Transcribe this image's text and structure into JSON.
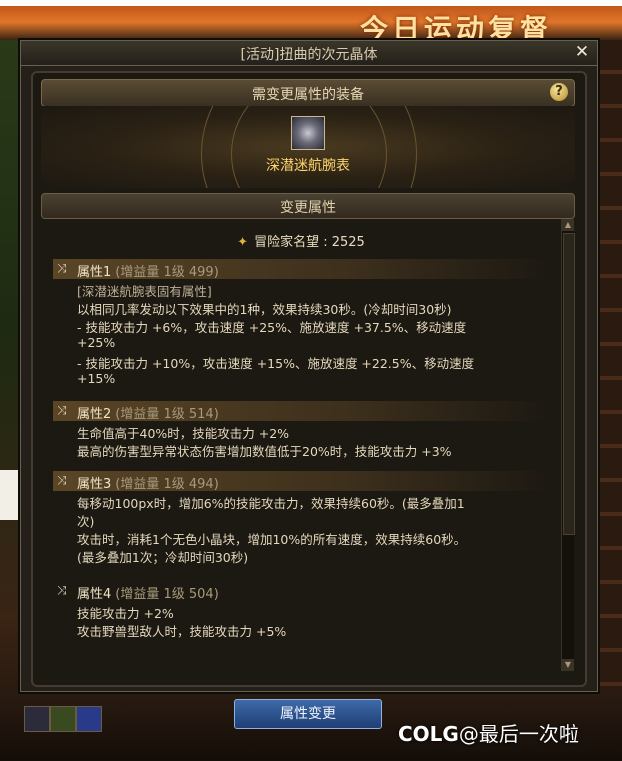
{
  "dialog": {
    "title": "[活动]扭曲的次元晶体",
    "close_icon": "✕"
  },
  "equipment": {
    "header": "需变更属性的装备",
    "help": "?",
    "item_name": "深潜迷航腕表"
  },
  "change": {
    "header": "变更属性",
    "fame_label": "冒险家名望 : 2525"
  },
  "attributes": [
    {
      "name": "属性1",
      "sub": "(增益量 1级 499)",
      "lines": [
        "[深潜迷航腕表固有属性]",
        "以相同几率发动以下效果中的1种，效果持续30秒。(冷却时间30秒)",
        "- 技能攻击力 +6%，攻击速度 +25%、施放速度 +37.5%、移动速度",
        "+25%",
        "- 技能攻击力 +10%，攻击速度 +15%、施放速度 +22.5%、移动速度",
        "+15%"
      ]
    },
    {
      "name": "属性2",
      "sub": "(增益量 1级 514)",
      "lines": [
        "生命值高于40%时，技能攻击力 +2%",
        "最高的伤害型异常状态伤害增加数值低于20%时，技能攻击力 +3%"
      ]
    },
    {
      "name": "属性3",
      "sub": "(增益量 1级 494)",
      "lines": [
        "每移动100px时，增加6%的技能攻击力，效果持续60秒。(最多叠加1",
        "次)",
        "攻击时，消耗1个无色小晶块，增加10%的所有速度，效果持续60秒。",
        "(最多叠加1次；冷却时间30秒)"
      ]
    },
    {
      "name": "属性4",
      "sub": "(增益量 1级 504)",
      "lines": [
        "技能攻击力 +2%",
        "攻击野兽型敌人时，技能攻击力 +5%"
      ]
    }
  ],
  "button_label": "属性变更",
  "watermark": {
    "logo": "COLG",
    "text": "@最后一次啦"
  },
  "background": {
    "banner_text": "今日运动复督"
  }
}
